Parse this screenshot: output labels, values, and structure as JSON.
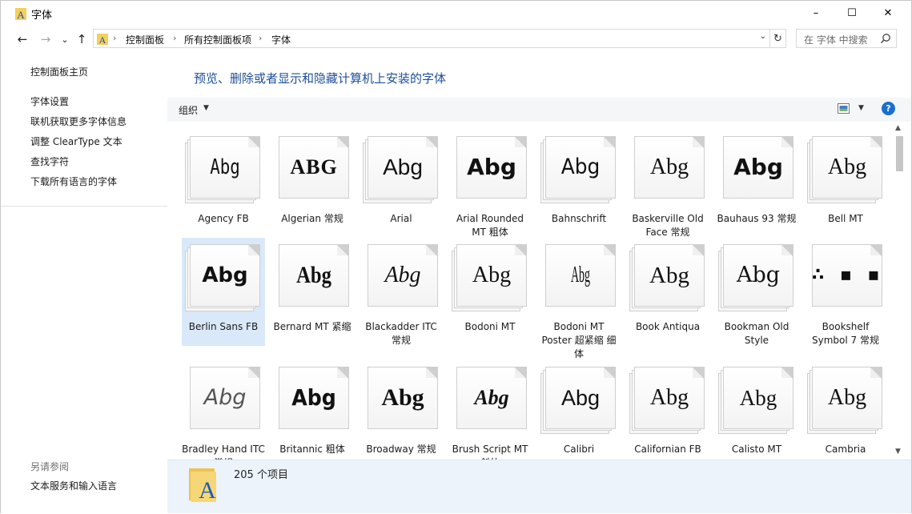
{
  "window": {
    "title": "字体",
    "minimize": "–",
    "maximize": "☐",
    "close": "✕"
  },
  "nav": {
    "back": "←",
    "forward": "→",
    "recent": "⌄",
    "up": "↑"
  },
  "address": {
    "crumbs": [
      "控制面板",
      "所有控制面板项",
      "字体"
    ],
    "separator": "›",
    "dropdown": "⌄",
    "refresh": "↻"
  },
  "search": {
    "placeholder": "在 字体 中搜索"
  },
  "sidebar": {
    "home": "控制面板主页",
    "links": [
      "字体设置",
      "联机获取更多字体信息",
      "调整 ClearType 文本",
      "查找字符",
      "下载所有语言的字体"
    ],
    "see_also": "另请参阅",
    "bottom_link": "文本服务和输入语言"
  },
  "main": {
    "heading": "预览、删除或者显示和隐藏计算机上安装的字体",
    "organize": "组织",
    "dropdown_arrow": "▼",
    "help": "?"
  },
  "fonts": [
    {
      "glyph": "Abg",
      "label": "Agency FB",
      "stacked": true
    },
    {
      "glyph": "ABG",
      "label": "Algerian 常规",
      "stacked": false
    },
    {
      "glyph": "Abg",
      "label": "Arial",
      "stacked": true
    },
    {
      "glyph": "Abg",
      "label": "Arial Rounded MT 粗体",
      "stacked": false
    },
    {
      "glyph": "Abg",
      "label": "Bahnschrift",
      "stacked": true
    },
    {
      "glyph": "Abg",
      "label": "Baskerville Old Face 常规",
      "stacked": false
    },
    {
      "glyph": "Abg",
      "label": "Bauhaus 93 常规",
      "stacked": false
    },
    {
      "glyph": "Abg",
      "label": "Bell MT",
      "stacked": true
    },
    {
      "glyph": "Abg",
      "label": "Berlin Sans FB",
      "stacked": true,
      "selected": true
    },
    {
      "glyph": "Abg",
      "label": "Bernard MT 紧缩",
      "stacked": false
    },
    {
      "glyph": "Abg",
      "label": "Blackadder ITC 常规",
      "stacked": false
    },
    {
      "glyph": "Abg",
      "label": "Bodoni MT",
      "stacked": true
    },
    {
      "glyph": "Abg",
      "label": "Bodoni MT Poster 超紧缩 细体",
      "stacked": false
    },
    {
      "glyph": "Abg",
      "label": "Book Antiqua",
      "stacked": true
    },
    {
      "glyph": "Abg",
      "label": "Bookman Old Style",
      "stacked": true
    },
    {
      "glyph": "∴ ▪ ▪",
      "label": "Bookshelf Symbol 7 常规",
      "stacked": false
    },
    {
      "glyph": "Abg",
      "label": "Bradley Hand ITC 常规",
      "stacked": false
    },
    {
      "glyph": "Abg",
      "label": "Britannic 粗体",
      "stacked": false
    },
    {
      "glyph": "Abg",
      "label": "Broadway 常规",
      "stacked": false
    },
    {
      "glyph": "Abg",
      "label": "Brush Script MT 斜体",
      "stacked": false
    },
    {
      "glyph": "Abg",
      "label": "Calibri",
      "stacked": true
    },
    {
      "glyph": "Abg",
      "label": "Californian FB",
      "stacked": true
    },
    {
      "glyph": "Abg",
      "label": "Calisto MT",
      "stacked": true
    },
    {
      "glyph": "Abg",
      "label": "Cambria",
      "stacked": true
    }
  ],
  "status": {
    "count": "205 个项目"
  },
  "colors": {
    "heading": "#1e4f9a",
    "selection": "#d9e9f9",
    "details_bg": "#edf3fb",
    "help": "#1b6fcf"
  }
}
